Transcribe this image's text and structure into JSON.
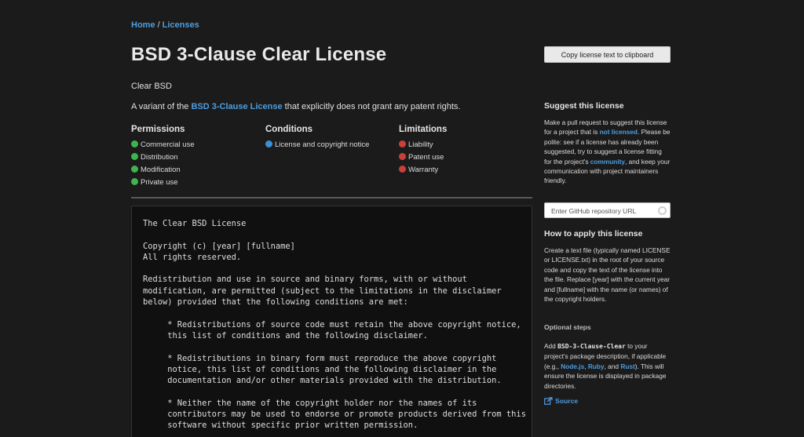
{
  "breadcrumb": {
    "home": "Home",
    "separator": "/",
    "current": "Licenses"
  },
  "license": {
    "title": "BSD 3-Clause Clear License",
    "nickname": "Clear BSD",
    "description_prefix": "A variant of the ",
    "description_link": "BSD 3-Clause License",
    "description_suffix": " that explicitly does not grant any patent rights."
  },
  "rules": {
    "permissions": {
      "heading": "Permissions",
      "color": "#3fb34f",
      "items": [
        "Commercial use",
        "Distribution",
        "Modification",
        "Private use"
      ]
    },
    "conditions": {
      "heading": "Conditions",
      "color": "#3b8fd8",
      "items": [
        "License and copyright notice"
      ]
    },
    "limitations": {
      "heading": "Limitations",
      "color": "#c9403a",
      "items": [
        "Liability",
        "Patent use",
        "Warranty"
      ]
    }
  },
  "license_text": "The Clear BSD License\n\nCopyright (c) [year] [fullname]\nAll rights reserved.\n\nRedistribution and use in source and binary forms, with or without\nmodification, are permitted (subject to the limitations in the disclaimer\nbelow) provided that the following conditions are met:\n\n     * Redistributions of source code must retain the above copyright notice,\n     this list of conditions and the following disclaimer.\n\n     * Redistributions in binary form must reproduce the above copyright\n     notice, this list of conditions and the following disclaimer in the\n     documentation and/or other materials provided with the distribution.\n\n     * Neither the name of the copyright holder nor the names of its\n     contributors may be used to endorse or promote products derived from this\n     software without specific prior written permission.",
  "sidebar": {
    "copy_button": "Copy license text to clipboard",
    "suggest": {
      "heading": "Suggest this license",
      "p1": "Make a pull request to suggest this license for a project that is ",
      "link1": "not licensed",
      "p2": ". Please be polite: see if a license has already been suggested, try to suggest a license fitting for the project's ",
      "link2": "community",
      "p3": ", and keep your communication with project maintainers friendly."
    },
    "repo_input_placeholder": "Enter GitHub repository URL",
    "apply": {
      "heading": "How to apply this license",
      "text": "Create a text file (typically named LICENSE or LICENSE.txt) in the root of your source code and copy the text of the license into the file. Replace [year] with the current year and [fullname] with the name (or names) of the copyright holders."
    },
    "optional": {
      "heading": "Optional steps",
      "p1": "Add ",
      "code": "BSD-3-Clause-Clear",
      "p2": " to your project's package description, if applicable (e.g., ",
      "link_node": "Node.js",
      "sep1": ", ",
      "link_ruby": "Ruby",
      "sep2": ", and ",
      "link_rust": "Rust",
      "p3": "). This will ensure the license is displayed in package directories."
    },
    "source_link": "Source"
  }
}
